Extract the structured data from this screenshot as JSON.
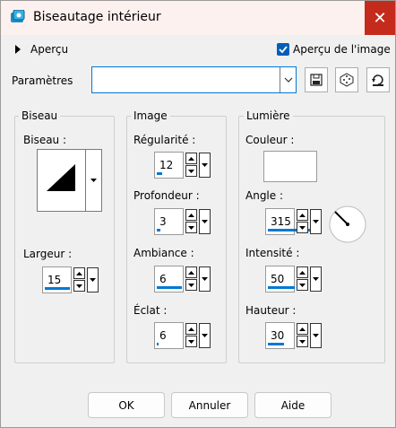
{
  "window": {
    "title": "Biseautage intérieur",
    "close_symbol": "✕"
  },
  "preview": {
    "label": "Aperçu",
    "image_preview_label": "Aperçu de l'image",
    "image_preview_checked": true
  },
  "presets": {
    "label": "Paramètres",
    "value": ""
  },
  "groups": {
    "biseau": {
      "title": "Biseau",
      "shape_label": "Biseau :",
      "width_label": "Largeur :",
      "width_value": "15"
    },
    "image": {
      "title": "Image",
      "smoothness_label": "Régularité :",
      "smoothness_value": "12",
      "depth_label": "Profondeur :",
      "depth_value": "3",
      "ambience_label": "Ambiance :",
      "ambience_value": "6",
      "shininess_label": "Éclat :",
      "shininess_value": "6"
    },
    "lumiere": {
      "title": "Lumière",
      "color_label": "Couleur :",
      "color_value": "#ffffff",
      "angle_label": "Angle :",
      "angle_value": "315",
      "intensity_label": "Intensité :",
      "intensity_value": "50",
      "elevation_label": "Hauteur :",
      "elevation_value": "30"
    }
  },
  "buttons": {
    "ok": "OK",
    "cancel": "Annuler",
    "help": "Aide"
  },
  "colors": {
    "accent": "#0078d4",
    "close": "#c42b1c",
    "titlebar": "#fdf1ef"
  }
}
